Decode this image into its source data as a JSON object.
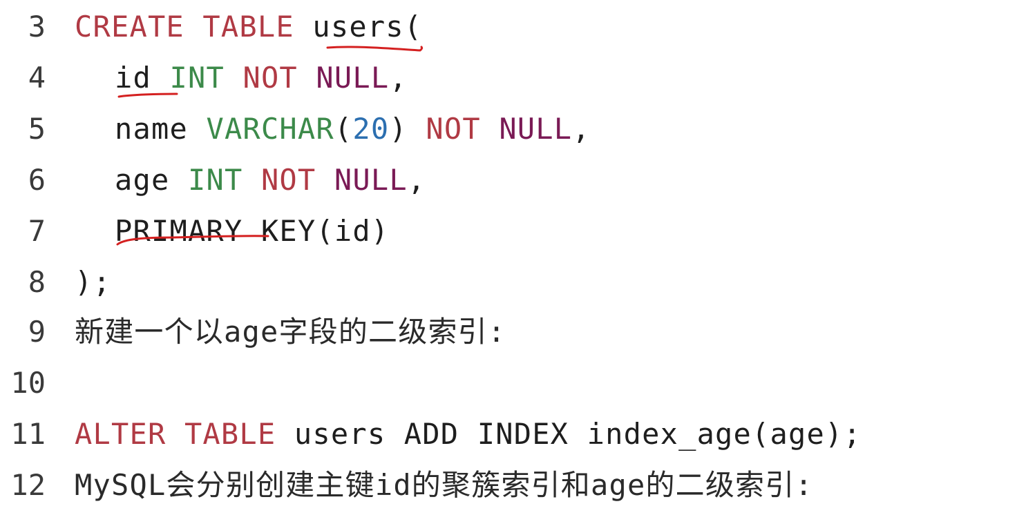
{
  "editor": {
    "lines": [
      {
        "num": "3",
        "tokens": [
          "CREATE",
          "TABLE",
          "users",
          "("
        ]
      },
      {
        "num": "4",
        "tokens": [
          "id",
          "INT",
          "NOT",
          "NULL",
          ","
        ]
      },
      {
        "num": "5",
        "tokens": [
          "name",
          "VARCHAR",
          "(",
          "20",
          ")",
          "NOT",
          "NULL",
          ","
        ]
      },
      {
        "num": "6",
        "tokens": [
          "age",
          "INT",
          "NOT",
          "NULL",
          ","
        ]
      },
      {
        "num": "7",
        "tokens": [
          "PRIMARY",
          "KEY",
          "(id)"
        ]
      },
      {
        "num": "8",
        "tokens": [
          ");"
        ]
      },
      {
        "num": "9",
        "tokens": [
          "新建一个以age字段的二级索引:"
        ]
      },
      {
        "num": "10",
        "tokens": []
      },
      {
        "num": "11",
        "tokens": [
          "ALTER",
          "TABLE",
          "users ADD INDEX index_age(age);"
        ]
      },
      {
        "num": "12",
        "tokens": [
          "MySQL会分别创建主键id的聚簇索引和age的二级索引:"
        ]
      }
    ]
  },
  "colors": {
    "keyword": "#b03a44",
    "type": "#3c8a4a",
    "null_keyword": "#7a1a55",
    "number": "#2c6fb0",
    "annotation": "#d42020"
  }
}
